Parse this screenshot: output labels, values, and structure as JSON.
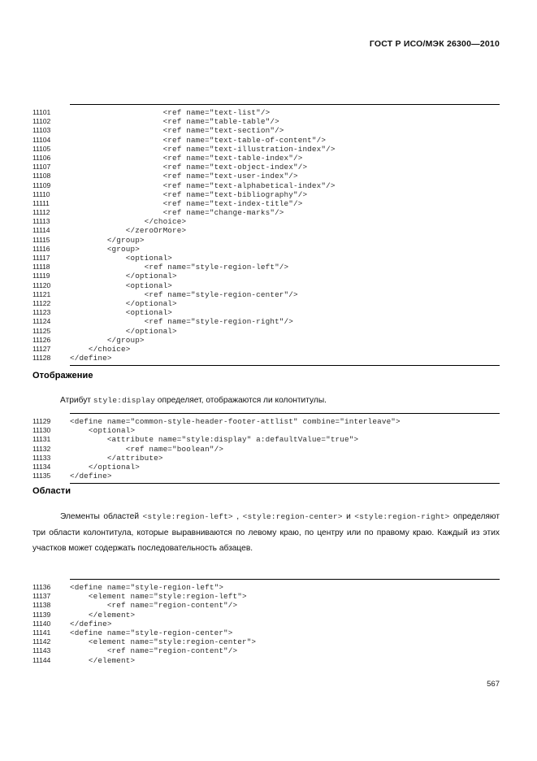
{
  "header": {
    "standard_title": "ГОСТ Р ИСО/МЭК 26300—2010"
  },
  "footer": {
    "page_number": "567"
  },
  "listings": [
    {
      "id": "listing-header-footer-content",
      "lines": [
        {
          "number": "11101",
          "code": "                    <ref name=\"text-list\"/>"
        },
        {
          "number": "11102",
          "code": "                    <ref name=\"table-table\"/>"
        },
        {
          "number": "11103",
          "code": "                    <ref name=\"text-section\"/>"
        },
        {
          "number": "11104",
          "code": "                    <ref name=\"text-table-of-content\"/>"
        },
        {
          "number": "11105",
          "code": "                    <ref name=\"text-illustration-index\"/>"
        },
        {
          "number": "11106",
          "code": "                    <ref name=\"text-table-index\"/>"
        },
        {
          "number": "11107",
          "code": "                    <ref name=\"text-object-index\"/>"
        },
        {
          "number": "11108",
          "code": "                    <ref name=\"text-user-index\"/>"
        },
        {
          "number": "11109",
          "code": "                    <ref name=\"text-alphabetical-index\"/>"
        },
        {
          "number": "11110",
          "code": "                    <ref name=\"text-bibliography\"/>"
        },
        {
          "number": "11111",
          "code": "                    <ref name=\"text-index-title\"/>"
        },
        {
          "number": "11112",
          "code": "                    <ref name=\"change-marks\"/>"
        },
        {
          "number": "11113",
          "code": "                </choice>"
        },
        {
          "number": "11114",
          "code": "            </zeroOrMore>"
        },
        {
          "number": "11115",
          "code": "        </group>"
        },
        {
          "number": "11116",
          "code": "        <group>"
        },
        {
          "number": "11117",
          "code": "            <optional>"
        },
        {
          "number": "11118",
          "code": "                <ref name=\"style-region-left\"/>"
        },
        {
          "number": "11119",
          "code": "            </optional>"
        },
        {
          "number": "11120",
          "code": "            <optional>"
        },
        {
          "number": "11121",
          "code": "                <ref name=\"style-region-center\"/>"
        },
        {
          "number": "11122",
          "code": "            </optional>"
        },
        {
          "number": "11123",
          "code": "            <optional>"
        },
        {
          "number": "11124",
          "code": "                <ref name=\"style-region-right\"/>"
        },
        {
          "number": "11125",
          "code": "            </optional>"
        },
        {
          "number": "11126",
          "code": "        </group>"
        },
        {
          "number": "11127",
          "code": "    </choice>"
        },
        {
          "number": "11128",
          "code": "</define>"
        }
      ]
    },
    {
      "id": "listing-common-style-header-footer-attlist",
      "lines": [
        {
          "number": "11129",
          "code": "<define name=\"common-style-header-footer-attlist\" combine=\"interleave\">"
        },
        {
          "number": "11130",
          "code": "    <optional>"
        },
        {
          "number": "11131",
          "code": "        <attribute name=\"style:display\" a:defaultValue=\"true\">"
        },
        {
          "number": "11132",
          "code": "            <ref name=\"boolean\"/>"
        },
        {
          "number": "11133",
          "code": "        </attribute>"
        },
        {
          "number": "11134",
          "code": "    </optional>"
        },
        {
          "number": "11135",
          "code": "</define>"
        }
      ]
    },
    {
      "id": "listing-style-region-definitions",
      "lines": [
        {
          "number": "11136",
          "code": "<define name=\"style-region-left\">"
        },
        {
          "number": "11137",
          "code": "    <element name=\"style:region-left\">"
        },
        {
          "number": "11138",
          "code": "        <ref name=\"region-content\"/>"
        },
        {
          "number": "11139",
          "code": "    </element>"
        },
        {
          "number": "11140",
          "code": "</define>"
        },
        {
          "number": "11141",
          "code": "<define name=\"style-region-center\">"
        },
        {
          "number": "11142",
          "code": "    <element name=\"style:region-center\">"
        },
        {
          "number": "11143",
          "code": "        <ref name=\"region-content\"/>"
        },
        {
          "number": "11144",
          "code": "    </element>"
        }
      ]
    }
  ],
  "sections": [
    {
      "id": "display",
      "heading": "Отображение",
      "paragraph": {
        "part1": "Атрибут ",
        "code1": "style:display",
        "part2": " определяет, отображаются ли колонтитулы."
      }
    },
    {
      "id": "regions",
      "heading": "Области",
      "paragraph": {
        "part1": "Элементы областей ",
        "code1": "<style:region-left>",
        "part2": " , ",
        "code2": "<style:region-center>",
        "part3": " и ",
        "code3": "<style:region-right>",
        "part4": " определяют три области колонтитула, которые выравниваются по левому краю, по центру или по правому краю. Каждый из этих участков может содержать последовательность абзацев."
      }
    }
  ]
}
